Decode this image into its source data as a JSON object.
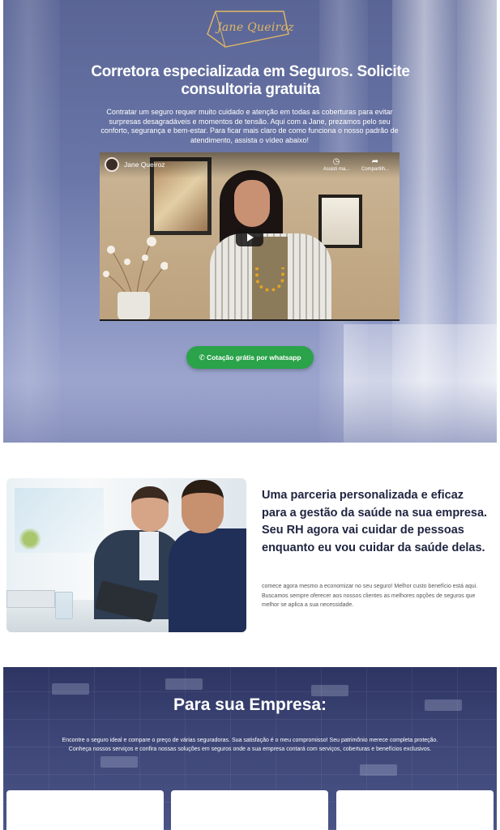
{
  "brand": {
    "logo_text": "Jane Queiroz",
    "logo_color": "#e2b763"
  },
  "hero": {
    "title": "Corretora especializada em Seguros. Solicite consultoria gratuita",
    "description": "Contratar um seguro requer muito cuidado e atenção em todas as coberturas para evitar surpresas desagradáveis e momentos de tensão. Aqui com a Jane, prezamos pelo seu conforto, segurança e bem-estar. Para ficar mais claro de como funciona o nosso padrão de atendimento, assista o vídeo abaixo!",
    "video": {
      "channel_name": "Jane Queiroz",
      "watch_later_label": "Assisti ma...",
      "share_label": "Compartilh..."
    },
    "cta": {
      "label": "Cotação grátis por whatsapp",
      "icon": "whatsapp-icon",
      "color": "#2aa34a"
    }
  },
  "partnership": {
    "title": "Uma parceria personalizada e eficaz para a gestão da saúde na sua empresa. Seu RH agora vai cuidar de pessoas enquanto eu vou cuidar da saúde delas.",
    "description": "comece agora mesmo a economizar no seu seguro! Melhor custo benefício está aqui. Buscamos sempre oferecer aos nossos clientes as melhores opções de seguros que melhor se aplica a sua necessidade."
  },
  "empresa": {
    "title": "Para sua Empresa:",
    "description_line1": "Encontre o seguro ideal e compare o preço de várias seguradoras. Sua satisfação é o meu compromisso! Seu patrimônio merece completa proteção.",
    "description_line2": "Conheça nossos serviços e confira nossas soluções em seguros onde a sua empresa contará com serviços, coberturas e benefícios exclusivos."
  }
}
